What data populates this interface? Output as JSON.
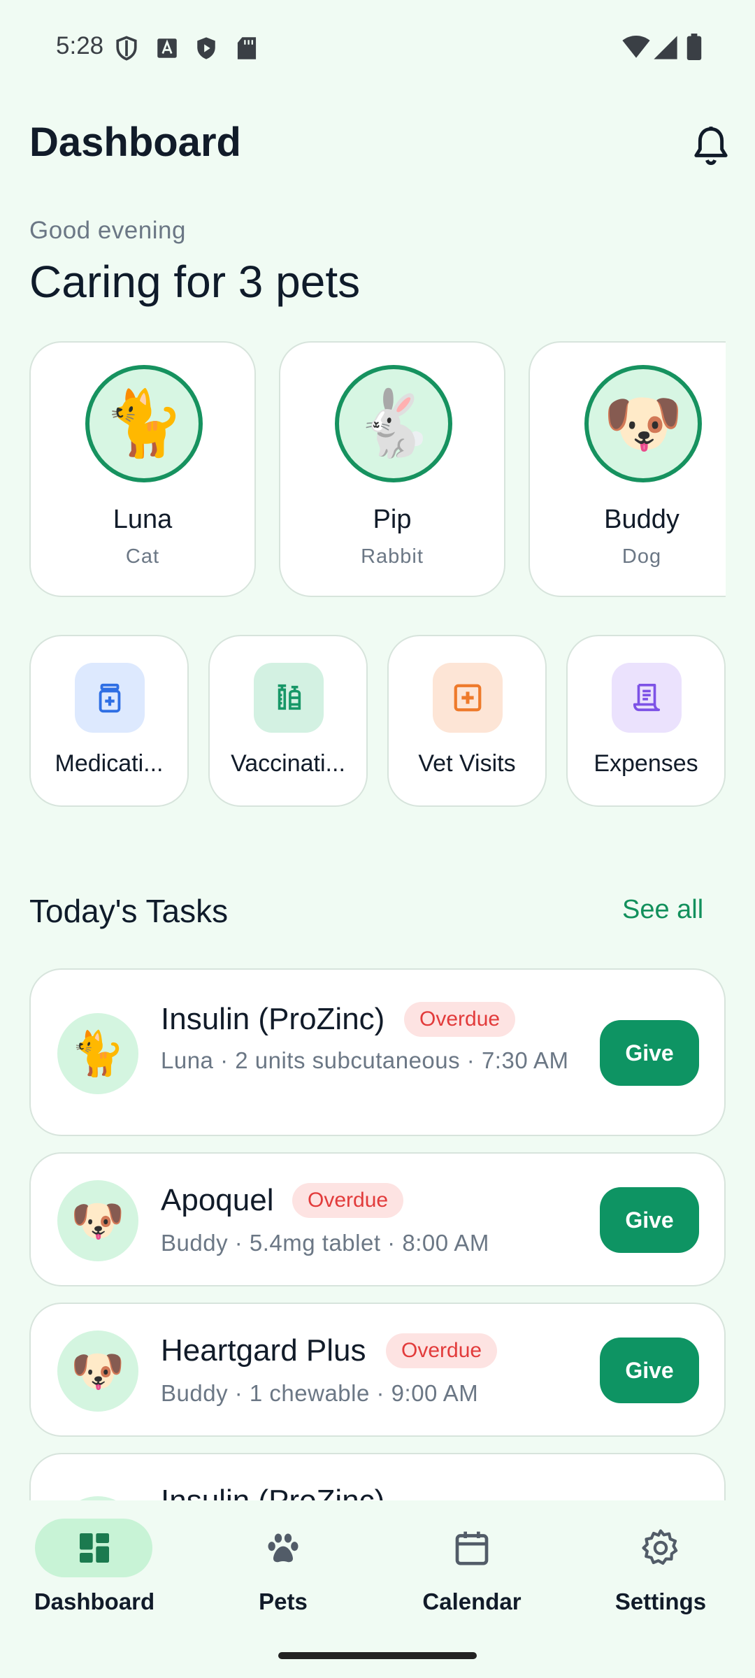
{
  "status_bar": {
    "time": "5:28"
  },
  "header": {
    "title": "Dashboard"
  },
  "greeting": "Good evening",
  "headline": "Caring for 3 pets",
  "pets": [
    {
      "name": "Luna",
      "type": "Cat",
      "emoji": "🐈"
    },
    {
      "name": "Pip",
      "type": "Rabbit",
      "emoji": "🐇"
    },
    {
      "name": "Buddy",
      "type": "Dog",
      "emoji": "🐶"
    }
  ],
  "categories": [
    {
      "label": "Medicati...",
      "icon": "medication-icon",
      "bg": "#dde9fe",
      "color": "#2f6fe4"
    },
    {
      "label": "Vaccinati...",
      "icon": "syringe-icon",
      "bg": "#d3f1e2",
      "color": "#179767"
    },
    {
      "label": "Vet Visits",
      "icon": "medical-kit-icon",
      "bg": "#fde5d6",
      "color": "#ee7a2b"
    },
    {
      "label": "Expenses",
      "icon": "receipt-icon",
      "bg": "#ebe2fd",
      "color": "#7d52e6"
    }
  ],
  "tasks_section": {
    "title": "Today's Tasks",
    "see_all": "See all"
  },
  "tasks": [
    {
      "name": "Insulin (ProZinc)",
      "badge": "Overdue",
      "meta": "Luna  ·  2 units subcutaneous  ·  7:30 AM",
      "action": "Give",
      "emoji": "🐈"
    },
    {
      "name": "Apoquel",
      "badge": "Overdue",
      "meta": "Buddy  ·  5.4mg tablet  ·  8:00 AM",
      "action": "Give",
      "emoji": "🐶"
    },
    {
      "name": "Heartgard Plus",
      "badge": "Overdue",
      "meta": "Buddy  ·  1 chewable  ·  9:00 AM",
      "action": "Give",
      "emoji": "🐶"
    },
    {
      "name": "Insulin (ProZinc)"
    }
  ],
  "nav": [
    {
      "label": "Dashboard",
      "icon": "dashboard-icon",
      "active": true
    },
    {
      "label": "Pets",
      "icon": "paw-icon"
    },
    {
      "label": "Calendar",
      "icon": "calendar-icon"
    },
    {
      "label": "Settings",
      "icon": "gear-icon"
    }
  ],
  "colors": {
    "accent": "#0e9463",
    "background": "#f0fbf3",
    "overdue": "#e23b3b"
  }
}
